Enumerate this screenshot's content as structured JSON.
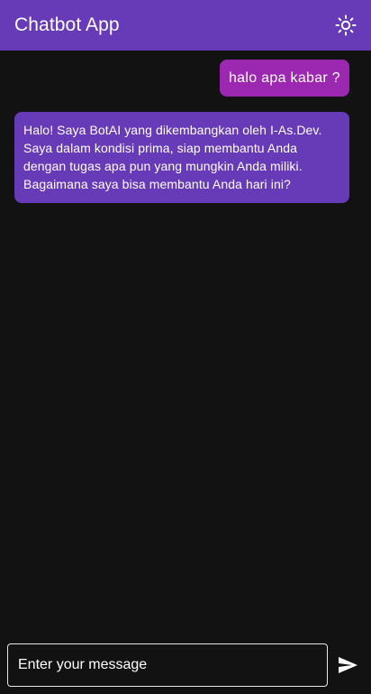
{
  "appbar": {
    "title": "Chatbot App",
    "theme_icon": "sun-icon",
    "color": "#673ab7"
  },
  "messages": [
    {
      "sender": "user",
      "text": "halo apa kabar ?",
      "color": "#9c27b0"
    },
    {
      "sender": "bot",
      "text": "Halo! Saya BotAI yang dikembangkan oleh I-As.Dev. Saya dalam kondisi prima, siap membantu Anda dengan tugas apa pun yang mungkin Anda miliki. Bagaimana saya bisa membantu Anda hari ini?",
      "color": "#673ab7"
    }
  ],
  "composer": {
    "placeholder": "Enter your message",
    "value": "",
    "send_icon": "send-icon"
  },
  "colors": {
    "background": "#121212"
  }
}
